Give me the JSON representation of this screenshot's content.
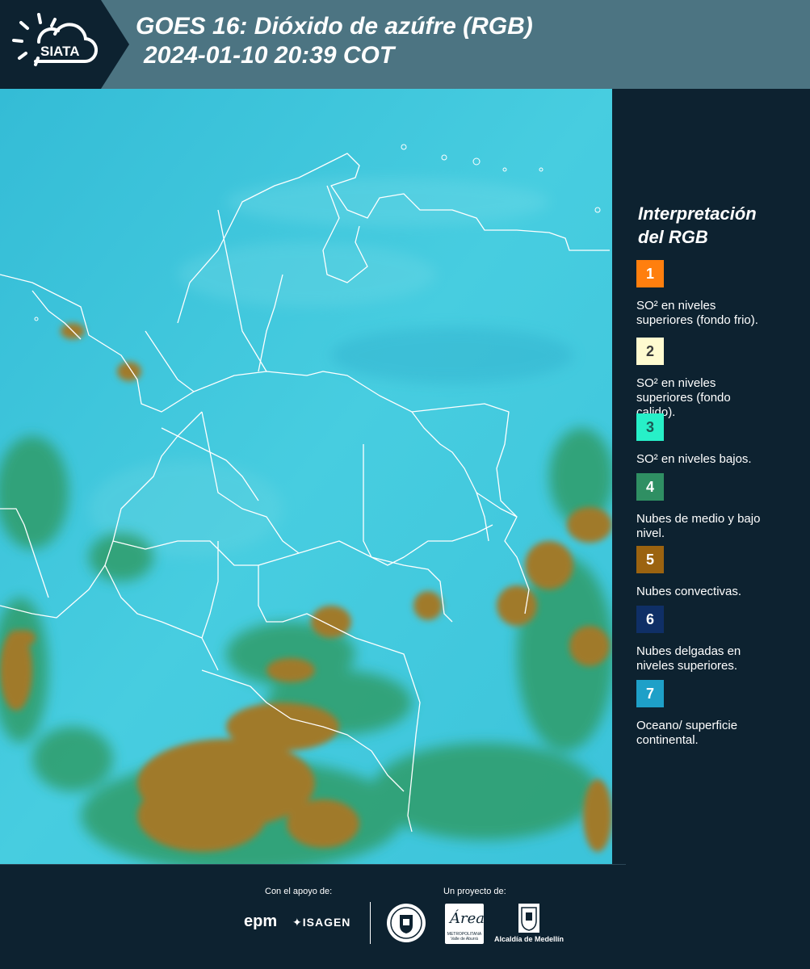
{
  "header": {
    "logo_text": "SIATA",
    "title_line1": "GOES 16: Dióxido de azúfre (RGB)",
    "title_line2": "2024-01-10 20:39 COT",
    "background_color": "#4c7482",
    "logo_band_color": "#0d2230"
  },
  "map": {
    "image_kind": "satellite-rgb-composite",
    "base_color": "#3ec6dc",
    "cloud_color": "#a07a2a",
    "low_cloud_color": "#2f9a62",
    "border_color": "#ffffff"
  },
  "legend": {
    "title_line1": "Interpretación",
    "title_line2": "del RGB",
    "items": [
      {
        "number": "1",
        "color": "#ff7f0e",
        "number_color": "#ffffff",
        "desc_line1": "SO² en niveles",
        "desc_line2": "superiores (fondo frio)."
      },
      {
        "number": "2",
        "color": "#fffbd0",
        "number_color": "#3a3a3a",
        "desc_line1": "SO² en niveles",
        "desc_line2": "superiores (fondo",
        "desc_line3": "calido)."
      },
      {
        "number": "3",
        "color": "#27f0c8",
        "number_color": "#1a5a55",
        "desc_line1": "SO² en niveles bajos."
      },
      {
        "number": "4",
        "color": "#2f8f63",
        "number_color": "#ffffff",
        "desc_line1": "Nubes de medio y bajo",
        "desc_line2": "nivel."
      },
      {
        "number": "5",
        "color": "#9b6310",
        "number_color": "#ffffff",
        "desc_line1": "Nubes convectivas."
      },
      {
        "number": "6",
        "color": "#0f2f66",
        "number_color": "#ffffff",
        "desc_line1": "Nubes delgadas en",
        "desc_line2": "niveles superiores."
      },
      {
        "number": "7",
        "color": "#1ea0c8",
        "number_color": "#ffffff",
        "desc_line1": "Oceano/ superficie",
        "desc_line2": "continental."
      }
    ]
  },
  "footer": {
    "support_label": "Con el apoyo de:",
    "project_label": "Un proyecto de:",
    "epm_logo": "epm",
    "isagen_logo": "ISAGEN",
    "area_logo_script": "Área",
    "area_logo_sub": "METROPOLITANA Valle de Aburrá",
    "alcaldia_label": "Alcaldía de Medellín"
  }
}
